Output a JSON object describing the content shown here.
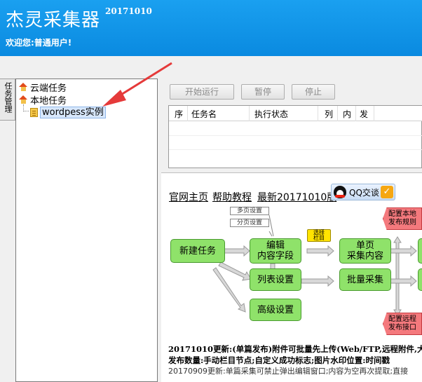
{
  "header": {
    "app_title": "杰灵采集器",
    "app_version": "20171010",
    "welcome": "欢迎您:普通用户!"
  },
  "side_tab": {
    "label": "任务管理"
  },
  "tree": {
    "items": [
      {
        "label": "云端任务",
        "icon": "house-icon"
      },
      {
        "label": "本地任务",
        "icon": "house-icon"
      },
      {
        "label": "wordpess实例",
        "icon": "file-icon"
      }
    ]
  },
  "toolbar": {
    "start_label": "开始运行",
    "pause_label": "暂停",
    "stop_label": "停止"
  },
  "task_table": {
    "columns": [
      "序",
      "任务名",
      "执行状态",
      "列",
      "内",
      "发"
    ]
  },
  "links": {
    "home": "官网主页",
    "help": "帮助教程",
    "latest": "最新20171010版",
    "qq_label": "QQ交谈"
  },
  "flow": {
    "new_task": "新建任务",
    "multi_page": "多页设置",
    "paging": "分页设置",
    "edit_fields": "编辑\n内容字段",
    "select_column": "选择\n栏目",
    "single_page": "单页\n采集内容",
    "list_settings": "列表设置",
    "batch_collect": "批量采集",
    "advanced": "高级设置",
    "config_local": "配置本地\n发布规则",
    "config_remote": "配置远程\n发布接口"
  },
  "notes": {
    "line1": "20171010更新:(单篇发布)附件可批量先上传(Web/FTP,远程附件,大",
    "line2": "发布数量:手动栏目节点;自定义成功标志;图片水印位置:时间戳",
    "line3": "20170909更新:单篇采集可禁止弹出编辑窗口;内容为空再次提取;直接"
  },
  "colors": {
    "header_bg": "#0a8ae0",
    "flow_green": "#8fe26a",
    "flow_red": "#f4797d",
    "annotation_arrow": "#e53a3a"
  }
}
